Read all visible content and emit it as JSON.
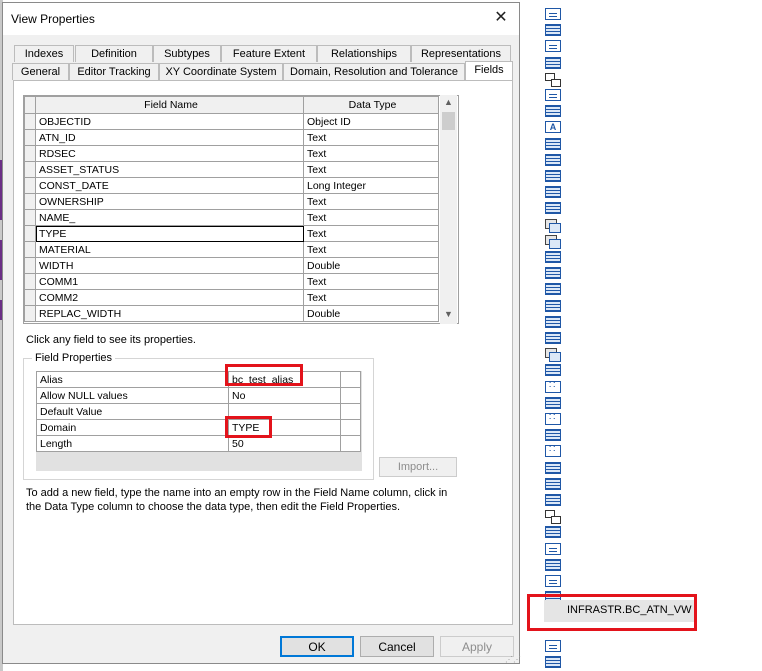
{
  "dialog": {
    "title": "View Properties",
    "tabs_row1": [
      "Indexes",
      "Definition",
      "Subtypes",
      "Feature Extent",
      "Relationships",
      "Representations"
    ],
    "tabs_row2": [
      "General",
      "Editor Tracking",
      "XY Coordinate System",
      "Domain, Resolution and Tolerance",
      "Fields"
    ],
    "active_tab": "Fields"
  },
  "fields_table": {
    "headers": [
      "Field Name",
      "Data Type"
    ],
    "rows": [
      {
        "name": "OBJECTID",
        "type": "Object ID"
      },
      {
        "name": "ATN_ID",
        "type": "Text"
      },
      {
        "name": "RDSEC",
        "type": "Text"
      },
      {
        "name": "ASSET_STATUS",
        "type": "Text"
      },
      {
        "name": "CONST_DATE",
        "type": "Long Integer"
      },
      {
        "name": "OWNERSHIP",
        "type": "Text"
      },
      {
        "name": "NAME_",
        "type": "Text"
      },
      {
        "name": "TYPE",
        "type": "Text"
      },
      {
        "name": "MATERIAL",
        "type": "Text"
      },
      {
        "name": "WIDTH",
        "type": "Double"
      },
      {
        "name": "COMM1",
        "type": "Text"
      },
      {
        "name": "COMM2",
        "type": "Text"
      },
      {
        "name": "REPLAC_WIDTH",
        "type": "Double"
      }
    ],
    "selected_row": "TYPE"
  },
  "hint_text": "Click any field to see its properties.",
  "field_properties": {
    "group_label": "Field Properties",
    "rows": [
      {
        "prop": "Alias",
        "value": "bc_test_alias"
      },
      {
        "prop": "Allow NULL values",
        "value": "No"
      },
      {
        "prop": "Default Value",
        "value": ""
      },
      {
        "prop": "Domain",
        "value": "TYPE"
      },
      {
        "prop": "Length",
        "value": "50"
      }
    ]
  },
  "import_button": "Import...",
  "instructions": "To add a new field, type the name into an empty row in the Field Name column, click in the Data Type column to choose the data type, then edit the Field Properties.",
  "buttons": {
    "ok": "OK",
    "cancel": "Cancel",
    "apply": "Apply"
  },
  "catalog_tree": {
    "icons": [
      "view",
      "table",
      "view",
      "table",
      "relationship",
      "view",
      "table",
      "annotation",
      "table",
      "table",
      "table",
      "table",
      "table",
      "duplicate",
      "duplicate",
      "table",
      "table",
      "table",
      "table",
      "table",
      "table",
      "duplicate",
      "table",
      "points",
      "table",
      "points",
      "table",
      "points",
      "table",
      "table",
      "table",
      "relationship",
      "table",
      "view",
      "table",
      "view",
      "table",
      "view",
      "view",
      "view",
      "table"
    ],
    "selected_item": "INFRASTR.BC_ATN_VW"
  },
  "colors": {
    "highlight": "#e3131b",
    "accent": "#0078d7"
  }
}
